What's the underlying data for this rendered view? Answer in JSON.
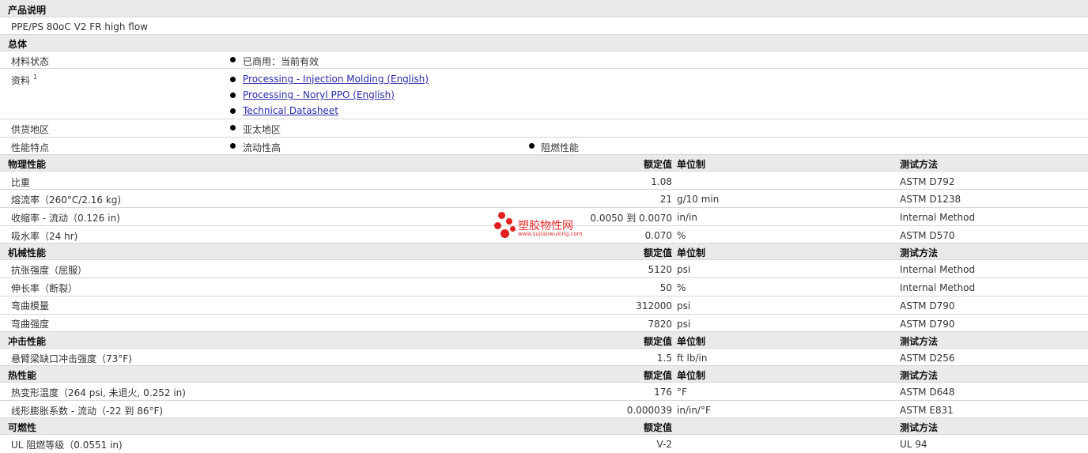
{
  "product_description": {
    "header": "产品说明",
    "text": "PPE/PS 80oC V2 FR high flow"
  },
  "general": {
    "header": "总体",
    "material_status": {
      "label": "材料状态",
      "value": "已商用：当前有效"
    },
    "documents": {
      "label": "资料",
      "footnote": "1",
      "links": [
        "Processing - Injection Molding (English)",
        "Processing - Noryl PPO (English)",
        "Technical Datasheet"
      ]
    },
    "supply_region": {
      "label": "供货地区",
      "value": "亚太地区"
    },
    "features": {
      "label": "性能特点",
      "values": [
        "流动性高",
        "阻燃性能"
      ]
    }
  },
  "column_headers": {
    "rated_value": "额定值",
    "unit": "单位制",
    "test_method": "测试方法"
  },
  "sections": {
    "physical": {
      "title": "物理性能",
      "rows": [
        {
          "name": "比重",
          "value": "1.08",
          "unit": "",
          "method": "ASTM D792"
        },
        {
          "name": "熔流率（260°C/2.16 kg)",
          "value": "21",
          "unit": "g/10 min",
          "method": "ASTM D1238"
        },
        {
          "name": "收缩率 - 流动（0.126 in)",
          "value": "0.0050 到  0.0070",
          "unit": "in/in",
          "method": "Internal Method"
        },
        {
          "name": "吸水率（24 hr)",
          "value": "0.070",
          "unit": "%",
          "method": "ASTM D570"
        }
      ]
    },
    "mechanical": {
      "title": "机械性能",
      "rows": [
        {
          "name": "抗张强度（屈服）",
          "value": "5120",
          "unit": "psi",
          "method": "Internal Method"
        },
        {
          "name": "伸长率（断裂）",
          "value": "50",
          "unit": "%",
          "method": "Internal Method"
        },
        {
          "name": "弯曲模量",
          "value": "312000",
          "unit": "psi",
          "method": "ASTM D790"
        },
        {
          "name": "弯曲强度",
          "value": "7820",
          "unit": "psi",
          "method": "ASTM D790"
        }
      ]
    },
    "impact": {
      "title": "冲击性能",
      "rows": [
        {
          "name": "悬臂梁缺口冲击强度（73°F)",
          "value": "1.5",
          "unit": "ft lb/in",
          "method": "ASTM D256"
        }
      ]
    },
    "thermal": {
      "title": "热性能",
      "rows": [
        {
          "name": "热变形温度（264 psi, 未退火, 0.252 in)",
          "value": "176",
          "unit": "°F",
          "method": "ASTM D648"
        },
        {
          "name": "线形膨胀系数 - 流动（-22 到  86°F)",
          "value": "0.000039",
          "unit": "in/in/°F",
          "method": "ASTM E831"
        }
      ]
    },
    "flammability": {
      "title": "可燃性",
      "rows": [
        {
          "name": "UL 阻燃等级（0.0551 in)",
          "value": "V-2",
          "unit": "",
          "method": "UL 94"
        }
      ]
    }
  },
  "watermark": {
    "title": "塑胶物性网",
    "url": "www.sujiaowuxing.com"
  }
}
